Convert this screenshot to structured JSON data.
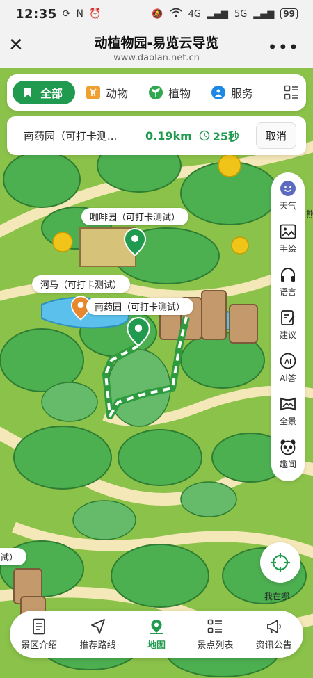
{
  "status_bar": {
    "time": "12:35",
    "network_4g": "4G",
    "network_5g": "5G",
    "battery": "99"
  },
  "header": {
    "title": "动植物园-易览云导览",
    "url": "www.daolan.net.cn"
  },
  "categories": [
    {
      "label": "全部",
      "active": true
    },
    {
      "label": "动物",
      "active": false
    },
    {
      "label": "植物",
      "active": false
    },
    {
      "label": "服务",
      "active": false
    }
  ],
  "route": {
    "destination": "南药园（可打卡测...",
    "distance": "0.19km",
    "duration": "25秒",
    "cancel_label": "取消"
  },
  "map_labels": {
    "coffee": "咖啡园（可打卡测试）",
    "hippo": "河马（可打卡测试）",
    "medicine": "南药园（可打卡测试）",
    "edge_left": "试）",
    "edge_right": "熊"
  },
  "tools": [
    "天气",
    "手绘",
    "语言",
    "建议",
    "Ai答",
    "全景",
    "趣闻"
  ],
  "locate_label": "我在哪",
  "bottom_nav": [
    {
      "label": "景区介绍",
      "icon": "document-icon",
      "active": false
    },
    {
      "label": "推荐路线",
      "icon": "navigation-arrow-icon",
      "active": false
    },
    {
      "label": "地图",
      "icon": "map-pin-icon",
      "active": true
    },
    {
      "label": "景点列表",
      "icon": "list-icon",
      "active": false
    },
    {
      "label": "资讯公告",
      "icon": "megaphone-icon",
      "active": false
    }
  ],
  "colors": {
    "accent": "#1f9a4e",
    "pin_orange": "#e8872e",
    "map_base": "#8bc34a",
    "path": "#f4e7b8"
  }
}
